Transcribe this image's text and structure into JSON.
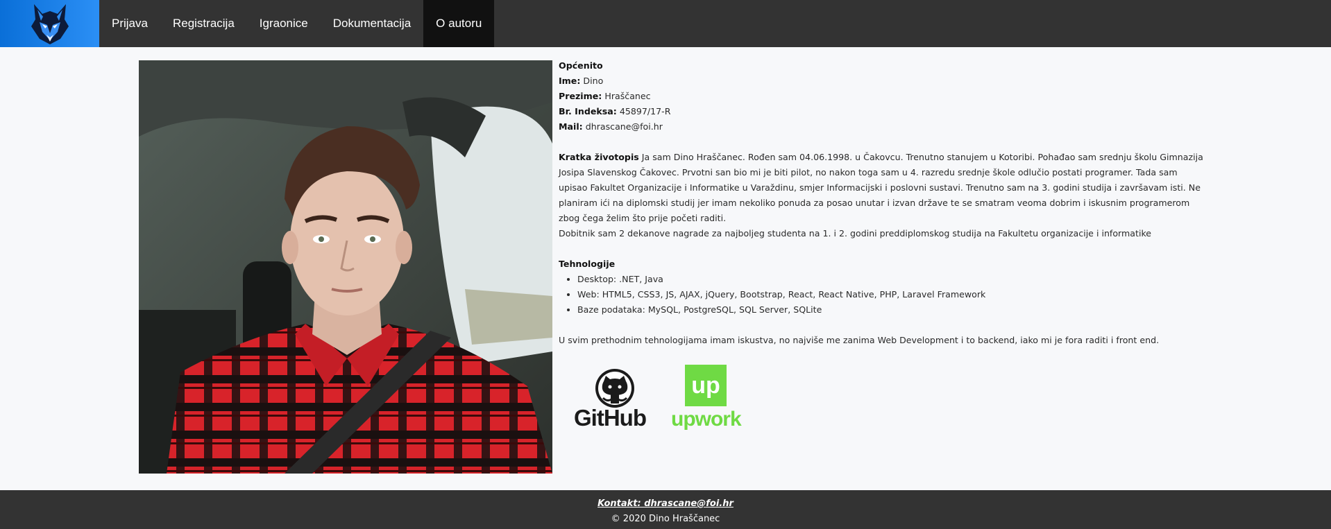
{
  "nav": {
    "logo_icon": "wolf-logo-icon",
    "items": [
      {
        "label": "Prijava",
        "active": false
      },
      {
        "label": "Registracija",
        "active": false
      },
      {
        "label": "Igraonice",
        "active": false
      },
      {
        "label": "Dokumentacija",
        "active": false
      },
      {
        "label": "O autoru",
        "active": true
      }
    ]
  },
  "profile": {
    "photo_icon": "author-photo",
    "general_heading": "Općenito",
    "name_label": "Ime:",
    "name_value": "Dino",
    "surname_label": "Prezime:",
    "surname_value": "Hraščanec",
    "index_label": "Br. Indeksa:",
    "index_value": "45897/17-R",
    "mail_label": "Mail:",
    "mail_value": "dhrascane@foi.hr",
    "bio_heading": "Kratka životopis",
    "bio_text": "Ja sam Dino Hraščanec. Rođen sam 04.06.1998. u Čakovcu. Trenutno stanujem u Kotoribi. Pohađao sam srednju školu Gimnazija Josipa Slavenskog Čakovec. Prvotni san bio mi je biti pilot, no nakon toga sam u 4. razredu srednje škole odlučio postati programer. Tada sam upisao Fakultet Organizacije i Informatike u Varaždinu, smjer Informacijski i poslovni sustavi. Trenutno sam na 3. godini studija i završavam isti. Ne planiram ići na diplomski studij jer imam nekoliko ponuda za posao unutar i izvan države te se smatram veoma dobrim i iskusnim programerom zbog čega želim što prije početi raditi.",
    "awards_text": "Dobitnik sam 2 dekanove nagrade za najboljeg studenta na 1. i 2. godini preddiplomskog studija na Fakultetu organizacije i informatike",
    "tech_heading": "Tehnologije",
    "tech_items": [
      "Desktop: .NET, Java",
      "Web: HTML5, CSS3, JS, AJAX, jQuery, Bootstrap, React, React Native, PHP, Laravel Framework",
      "Baze podataka: MySQL, PostgreSQL, SQL Server, SQLite"
    ],
    "experience_text": "U svim prethodnim tehnologijama imam iskustva, no najviše me zanima Web Development i to backend, iako mi je fora raditi i front end.",
    "github_label": "GitHub",
    "upwork_label": "upwork",
    "upwork_badge": "Up",
    "colors": {
      "upwork_green": "#6fda44",
      "github_dark": "#1b1b1b"
    }
  },
  "footer": {
    "contact_label": "Kontakt: dhrascane@foi.hr",
    "copyright": "© 2020 Dino Hraščanec"
  }
}
